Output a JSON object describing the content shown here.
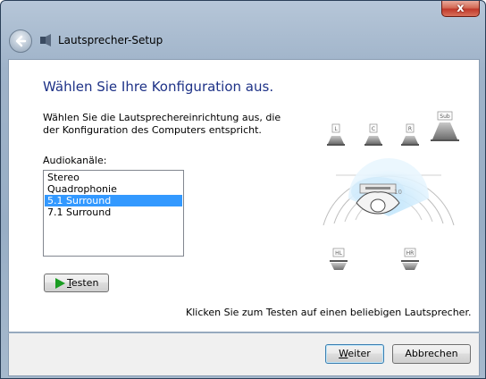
{
  "window": {
    "title": "Lautsprecher-Setup",
    "close_glyph": "x"
  },
  "main": {
    "heading": "Wählen Sie Ihre Konfiguration aus.",
    "description_line1": "Wählen Sie die Lautsprechereinrichtung aus, die",
    "description_line2": "der Konfiguration des Computers entspricht.",
    "channels_label": "Audiokanäle:",
    "channels": [
      "Stereo",
      "Quadrophonie",
      "5.1 Surround",
      "7.1 Surround"
    ],
    "selected_channel": "5.1 Surround",
    "test_button_mnemonic": "T",
    "test_button_rest": "esten",
    "hint": "Klicken Sie zum Testen auf einen beliebigen Lautsprecher."
  },
  "diagram": {
    "speakers": {
      "left": "L",
      "center": "C",
      "right": "R",
      "subwoofer": "Sub",
      "rear_left": "HL",
      "rear_right": "HR"
    }
  },
  "footer": {
    "next_mnemonic": "W",
    "next_rest": "eiter",
    "cancel": "Abbrechen"
  },
  "colors": {
    "heading": "#1e3287",
    "selection": "#3399ff",
    "test_play": "#1a9c22"
  }
}
